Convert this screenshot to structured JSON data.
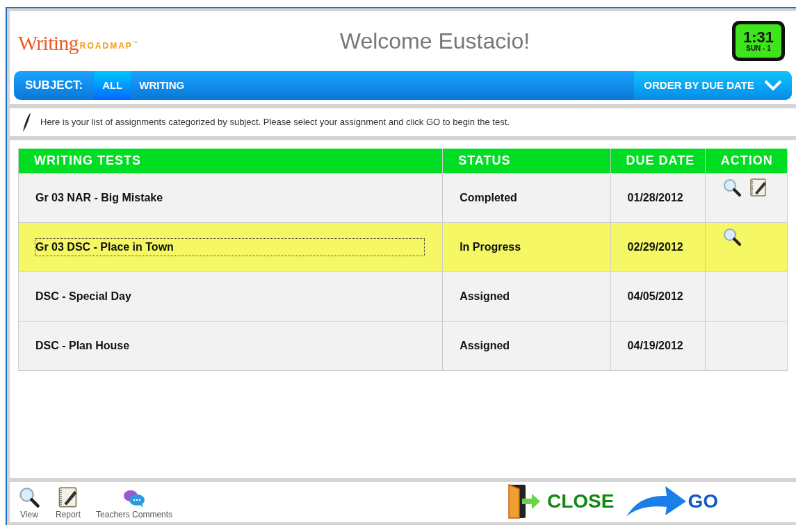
{
  "logo": {
    "word": "Writing",
    "sub": "ROADMAP",
    "tm": "™"
  },
  "welcome": "Welcome Eustacio!",
  "clock": {
    "time": "1:31",
    "day": "SUN - 1"
  },
  "subject_bar": {
    "label": "SUBJECT:",
    "tabs": [
      {
        "label": "ALL",
        "selected": true
      },
      {
        "label": "WRITING",
        "selected": false
      }
    ],
    "order": "ORDER BY DUE DATE"
  },
  "instructions": "Here is your list of assignments categorized by subject. Please select your assignment and click GO to begin the test.",
  "table": {
    "columns": [
      "WRITING TESTS",
      "STATUS",
      "DUE DATE",
      "ACTION"
    ],
    "rows": [
      {
        "name": "Gr 03 NAR  - Big Mistake",
        "status": "Completed",
        "due": "01/28/2012",
        "view": true,
        "report": true,
        "selected": false
      },
      {
        "name": "Gr 03 DSC - Place in Town",
        "status": "In Progress",
        "due": "02/29/2012",
        "view": true,
        "report": false,
        "selected": true
      },
      {
        "name": "DSC - Special Day",
        "status": "Assigned",
        "due": "04/05/2012",
        "view": false,
        "report": false,
        "selected": false
      },
      {
        "name": "DSC - Plan House",
        "status": "Assigned",
        "due": "04/19/2012",
        "view": false,
        "report": false,
        "selected": false
      }
    ]
  },
  "footer": {
    "tools": [
      {
        "kind": "view",
        "label": "View"
      },
      {
        "kind": "report",
        "label": "Report"
      },
      {
        "kind": "comments",
        "label": "Teachers Comments"
      }
    ],
    "close": "CLOSE",
    "go": "GO"
  }
}
